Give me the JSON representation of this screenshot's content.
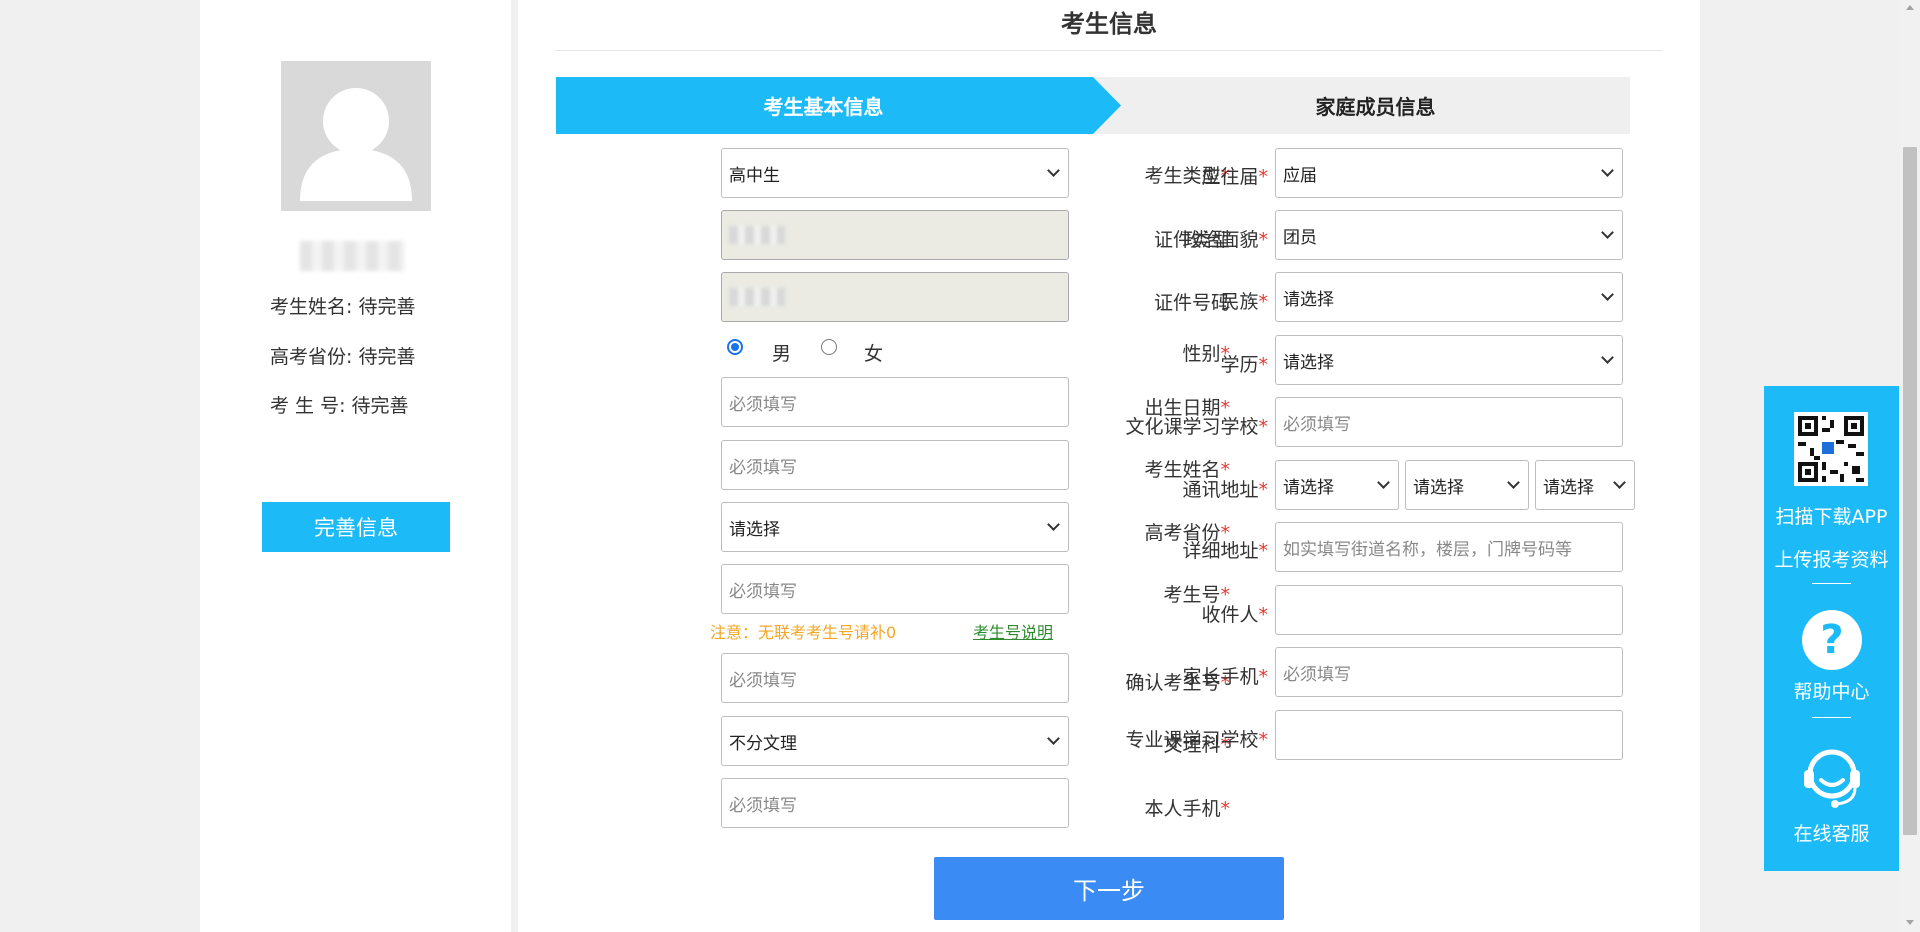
{
  "sidebar": {
    "info": [
      {
        "label": "考生姓名: ",
        "value": "待完善"
      },
      {
        "label": "高考省份: ",
        "value": "待完善"
      },
      {
        "label": "考 生 号: ",
        "value": "待完善"
      }
    ],
    "complete_button": "完善信息"
  },
  "main": {
    "title": "考生信息",
    "tabs": [
      {
        "label": "考生基本信息",
        "active": true
      },
      {
        "label": "家庭成员信息",
        "active": false
      }
    ],
    "left_fields": {
      "exam_type": {
        "label": "考生类型",
        "value": "高中生"
      },
      "id_type": {
        "label": "证件类型"
      },
      "id_number": {
        "label": "证件号码"
      },
      "gender": {
        "label": "性别",
        "options": [
          "男",
          "女"
        ],
        "selected": "男"
      },
      "birth_date": {
        "label": "出生日期",
        "placeholder": "必须填写"
      },
      "name": {
        "label": "考生姓名",
        "placeholder": "必须填写"
      },
      "province": {
        "label": "高考省份",
        "value": "请选择"
      },
      "exam_number": {
        "label": "考生号",
        "placeholder": "必须填写"
      },
      "confirm_number": {
        "label": "确认考生号",
        "placeholder": "必须填写"
      },
      "subject": {
        "label": "文理科",
        "value": "不分文理"
      },
      "phone": {
        "label": "本人手机",
        "placeholder": "必须填写"
      }
    },
    "note": {
      "text": "注意：无联考考生号请补0",
      "link": "考生号说明"
    },
    "right_fields": {
      "grad_status": {
        "label": "应往届",
        "value": "应届"
      },
      "political": {
        "label": "政治面貌",
        "value": "团员"
      },
      "ethnicity": {
        "label": "民族",
        "value": "请选择"
      },
      "education": {
        "label": "学历",
        "value": "请选择"
      },
      "culture_school": {
        "label": "文化课学习学校",
        "placeholder": "必须填写"
      },
      "address": {
        "label": "通讯地址",
        "province": "请选择",
        "city": "请选择",
        "district": "请选择"
      },
      "detail_address": {
        "label": "详细地址",
        "placeholder": "如实填写街道名称，楼层，门牌号码等"
      },
      "recipient": {
        "label": "收件人",
        "value": ""
      },
      "parent_phone": {
        "label": "家长手机",
        "placeholder": "必须填写"
      },
      "major_school": {
        "label": "专业课学习学校",
        "value": ""
      }
    },
    "required_mark": "*",
    "next_button": "下一步"
  },
  "float_panel": {
    "scan_text": "扫描下载APP",
    "upload_text": "上传报考资料",
    "help_text": "帮助中心",
    "service_text": "在线客服"
  },
  "colors": {
    "accent": "#1cbbf8",
    "primary_button": "#3b8bf4",
    "required": "#e53935",
    "note": "#f5a623",
    "link": "#2e8b2e"
  }
}
